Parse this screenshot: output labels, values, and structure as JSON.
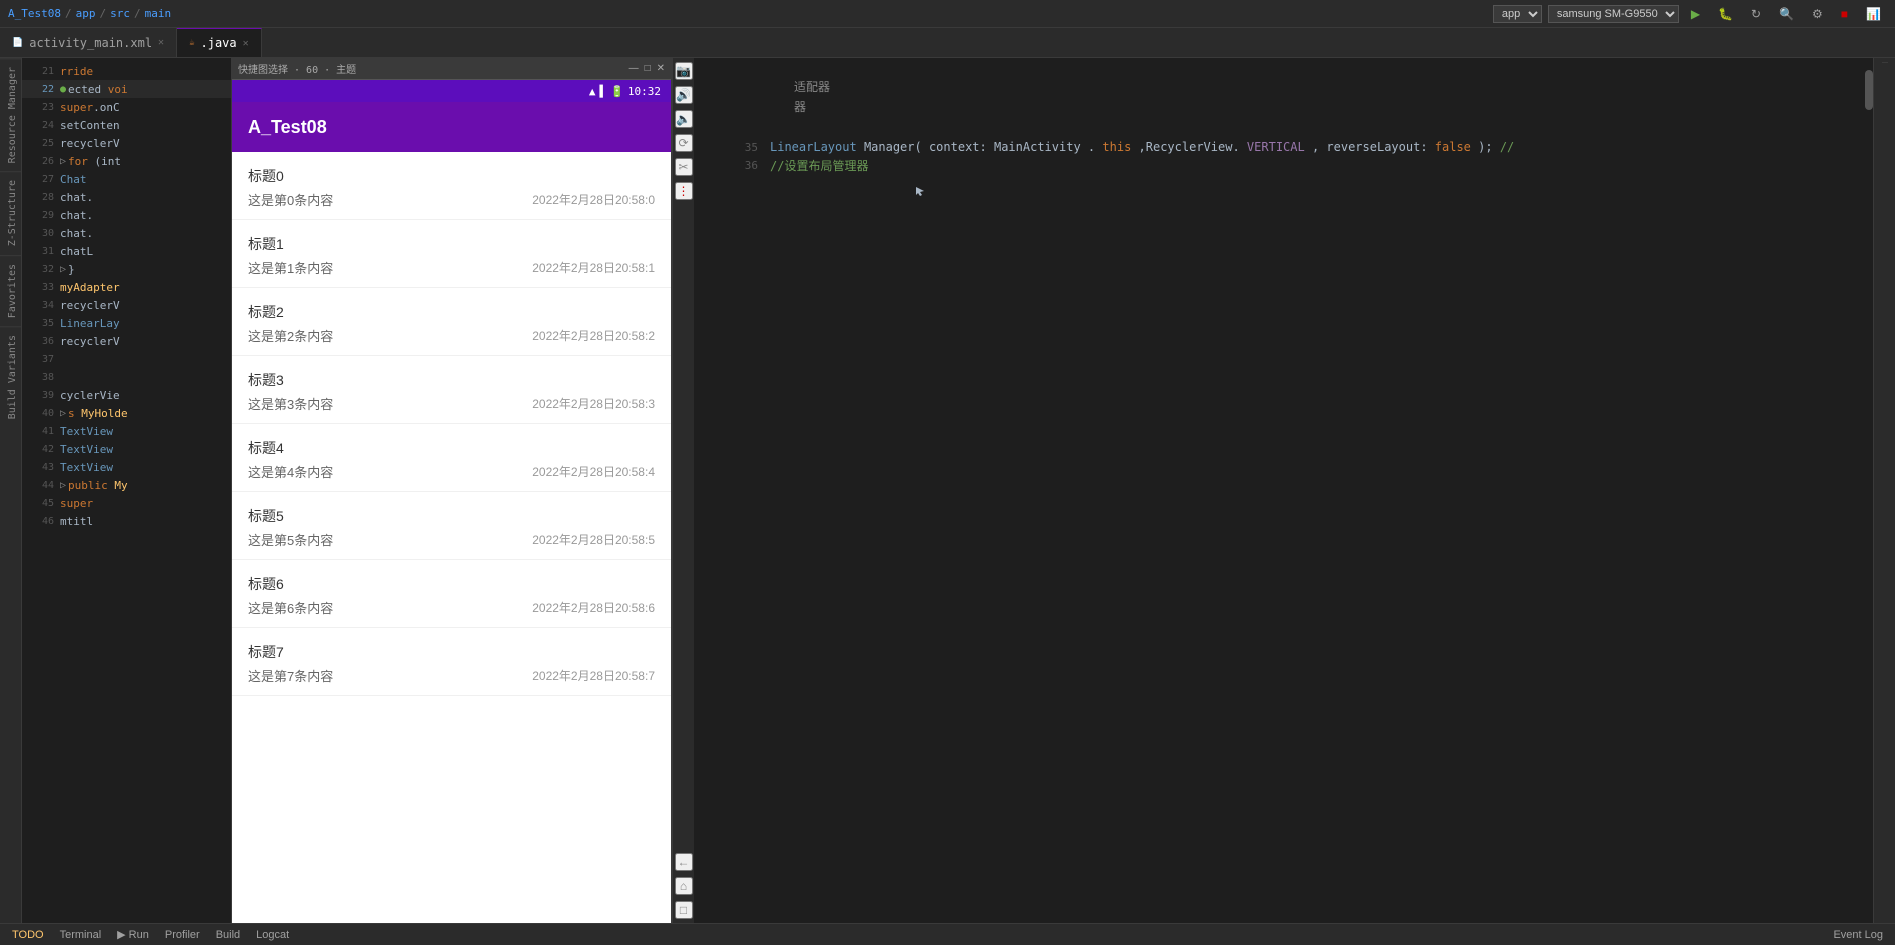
{
  "topBar": {
    "breadcrumb": [
      "A_Test08",
      "app",
      "src",
      "main"
    ],
    "appName": "A_Test08",
    "deviceName": "samsung SM-G9550",
    "runBtn": "▶",
    "buildBtn": "🔨",
    "settingsBtn": "⚙"
  },
  "tabs": [
    {
      "id": "activity_main_xml",
      "label": "activity_main.xml",
      "active": false
    },
    {
      "id": "main_java",
      "label": ".java",
      "active": true
    }
  ],
  "phone": {
    "appTitle": "A_Test08",
    "statusTime": "10:32",
    "chatItems": [
      {
        "title": "标题0",
        "content": "这是第0条内容",
        "time": "2022年2月28日20:58:0"
      },
      {
        "title": "标题1",
        "content": "这是第1条内容",
        "time": "2022年2月28日20:58:1"
      },
      {
        "title": "标题2",
        "content": "这是第2条内容",
        "time": "2022年2月28日20:58:2"
      },
      {
        "title": "标题3",
        "content": "这是第3条内容",
        "time": "2022年2月28日20:58:3"
      },
      {
        "title": "标题4",
        "content": "这是第4条内容",
        "time": "2022年2月28日20:58:4"
      },
      {
        "title": "标题5",
        "content": "这是第5条内容",
        "time": "2022年2月28日20:58:5"
      },
      {
        "title": "标题6",
        "content": "这是第6条内容",
        "time": "2022年2月28日20:58:6"
      },
      {
        "title": "标题7",
        "content": "这是第7条内容",
        "time": "2022年2月28日20:58:7"
      }
    ]
  },
  "codeLines": [
    {
      "num": "21",
      "content": "    rride",
      "highlight": false
    },
    {
      "num": "22",
      "content": "    ected voi",
      "highlight": true
    },
    {
      "num": "23",
      "content": "        super.onC",
      "highlight": false
    },
    {
      "num": "24",
      "content": "        setConten",
      "highlight": false
    },
    {
      "num": "25",
      "content": "        recyclerV",
      "highlight": false
    },
    {
      "num": "26",
      "content": "    for (int",
      "highlight": false
    },
    {
      "num": "27",
      "content": "            Chat",
      "highlight": false
    },
    {
      "num": "28",
      "content": "            chat.",
      "highlight": false
    },
    {
      "num": "29",
      "content": "            chat.",
      "highlight": false
    },
    {
      "num": "30",
      "content": "            chat.",
      "highlight": false
    },
    {
      "num": "31",
      "content": "            chatL",
      "highlight": false
    },
    {
      "num": "32",
      "content": "    }",
      "highlight": false
    },
    {
      "num": "33",
      "content": "    myAdapter",
      "highlight": false
    },
    {
      "num": "34",
      "content": "    recyclerV",
      "highlight": false
    },
    {
      "num": "35",
      "content": "    LinearLay",
      "highlight": false
    },
    {
      "num": "36",
      "content": "    recyclerV",
      "highlight": false
    },
    {
      "num": "37",
      "content": "",
      "highlight": false
    },
    {
      "num": "38",
      "content": "",
      "highlight": false
    },
    {
      "num": "39",
      "content": "    cyclerVie",
      "highlight": false
    },
    {
      "num": "40",
      "content": "    s MyHolde",
      "highlight": false
    },
    {
      "num": "41",
      "content": "    TextView",
      "highlight": false
    },
    {
      "num": "42",
      "content": "    TextView",
      "highlight": false
    },
    {
      "num": "43",
      "content": "    TextView",
      "highlight": false
    },
    {
      "num": "44",
      "content": "    public My",
      "highlight": false
    },
    {
      "num": "45",
      "content": "        super",
      "highlight": false
    },
    {
      "num": "46",
      "content": "        mtitl",
      "highlight": false
    }
  ],
  "mainCodeLines": [
    {
      "num": "35",
      "content": "LinearLayout Manager( context: MainActivity.this,RecyclerView.VERTICAL, reverseLayout: false);  //",
      "parts": [
        {
          "text": "LinearLayout",
          "color": "#a9b7c6"
        },
        {
          "text": " Manager( context: ",
          "color": "#a9b7c6"
        },
        {
          "text": "MainActivity",
          "color": "#a9b7c6"
        },
        {
          "text": ".",
          "color": "#a9b7c6"
        },
        {
          "text": "this",
          "color": "#cc7832"
        },
        {
          "text": ",RecyclerView.",
          "color": "#a9b7c6"
        },
        {
          "text": "VERTICAL",
          "color": "#9876aa"
        },
        {
          "text": ", reverseLayout: ",
          "color": "#a9b7c6"
        },
        {
          "text": "false",
          "color": "#cc7832"
        },
        {
          "text": ");",
          "color": "#a9b7c6"
        },
        {
          "text": "  //",
          "color": "#a9b7c6"
        }
      ]
    },
    {
      "num": "36",
      "content": "        //设置布局管理器",
      "comment": true
    }
  ],
  "annotations": {
    "adapter": "适配器",
    "manager": "器"
  },
  "bottomBar": {
    "todo": "TODO",
    "terminal": "Terminal",
    "run": "▶ Run",
    "profiler": "Profiler",
    "build": "Build",
    "logcat": "Logcat",
    "eventLog": "Event Log"
  },
  "sideLabels": {
    "resourceManager": "Resource Manager",
    "zStructure": "Z-Structure",
    "buildVariants": "Build Variants",
    "favorites": "Favorites"
  }
}
